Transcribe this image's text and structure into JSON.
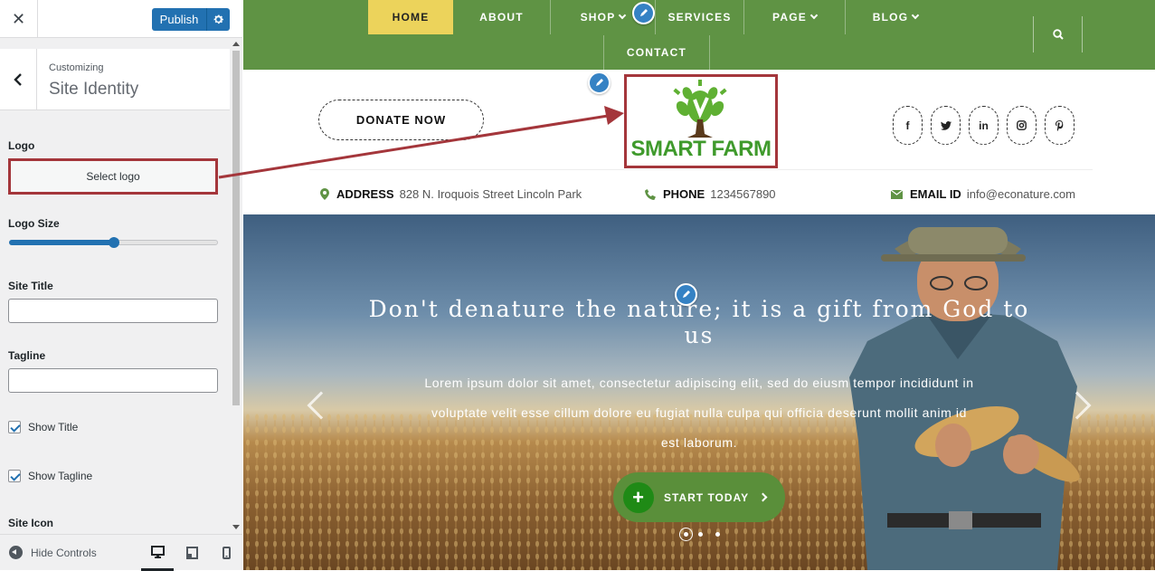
{
  "customizer": {
    "close_glyph": "✕",
    "publish_label": "Publish",
    "section_kicker": "Customizing",
    "section_title": "Site Identity",
    "logo_label": "Logo",
    "select_logo_label": "Select logo",
    "logo_size_label": "Logo Size",
    "logo_size_fraction": 0.5,
    "site_title_label": "Site Title",
    "site_title_value": "",
    "tagline_label": "Tagline",
    "tagline_value": "",
    "show_title_label": "Show Title",
    "show_title_checked": true,
    "show_tagline_label": "Show Tagline",
    "show_tagline_checked": true,
    "site_icon_label": "Site Icon",
    "hide_controls_label": "Hide Controls",
    "devices": [
      "desktop-icon",
      "tablet-icon",
      "mobile-icon"
    ],
    "accent_color": "#2271b1",
    "highlight_color": "#a4363b"
  },
  "site": {
    "nav": {
      "items": [
        {
          "label": "HOME",
          "active": true
        },
        {
          "label": "ABOUT"
        },
        {
          "label": "SHOP",
          "dropdown": true
        },
        {
          "label": "SERVICES"
        },
        {
          "label": "PAGE",
          "dropdown": true
        },
        {
          "label": "BLOG",
          "dropdown": true
        },
        {
          "label": "CONTACT"
        }
      ],
      "bg_color": "#5f9344",
      "active_color": "#ecd35b"
    },
    "donate_label": "DONATE NOW",
    "logo_text": "SMART FARM",
    "social": [
      "f",
      "twitter-icon",
      "in",
      "instagram-icon",
      "pinterest-icon"
    ],
    "info": {
      "address_key": "ADDRESS",
      "address_value": "828 N. Iroquois Street Lincoln Park",
      "phone_key": "PHONE",
      "phone_value": "1234567890",
      "email_key": "EMAIL ID",
      "email_value": "info@econature.com"
    },
    "hero": {
      "title": "Don't denature the nature; it is a gift from God to us",
      "body": "Lorem ipsum dolor sit amet, consectetur adipiscing elit, sed do eiusm tempor incididunt in voluptate velit esse cillum dolore eu fugiat nulla culpa qui officia deserunt mollit anim id est laborum.",
      "cta_label": "START TODAY",
      "slide_count": 3,
      "active_slide": 1
    }
  }
}
